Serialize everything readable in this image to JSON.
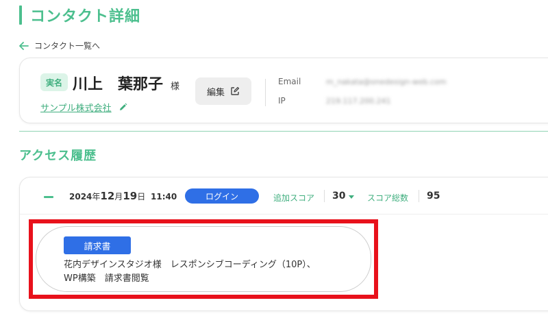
{
  "page": {
    "title": "コンタクト詳細",
    "back_link": "コンタクト一覧へ"
  },
  "contact": {
    "badge": "実名",
    "name": "川上　葉那子",
    "honorific": "様",
    "company": "サンプル株式会社",
    "edit_label": "編集",
    "email_label": "Email",
    "email_value": "m_nakata@onedesign-web.com",
    "ip_label": "IP",
    "ip_value": "219.117.200.241"
  },
  "access_history": {
    "title": "アクセス履歴",
    "entry": {
      "year": "2024",
      "year_suffix": "年",
      "month": "12",
      "month_suffix": "月",
      "day": "19",
      "day_suffix": "日",
      "time": "11:40",
      "event_badge": "ログイン",
      "added_score_label": "追加スコア",
      "added_score_value": "30",
      "total_score_label": "スコア総数",
      "total_score_value": "95",
      "document": {
        "badge": "請求書",
        "text": "花内デザインスタジオ様　レスポンシブコーディング（10P）、\nWP構築　請求書閲覧"
      }
    }
  },
  "colors": {
    "accent_green": "#4cbf8e",
    "badge_blue": "#2f6fe6",
    "highlight_red": "#e8111b"
  },
  "icons": [
    "back-arrow-icon",
    "pencil-icon",
    "edit-external-icon",
    "collapse-minus-icon",
    "dropdown-caret-icon"
  ]
}
